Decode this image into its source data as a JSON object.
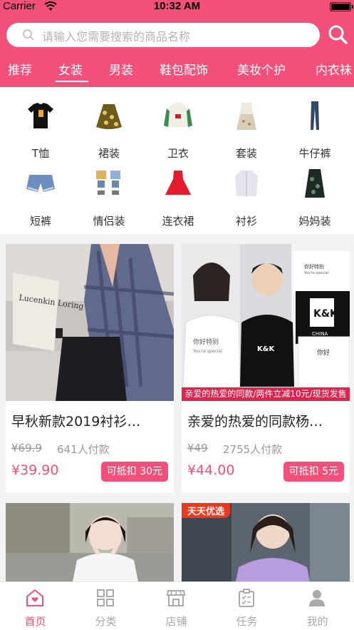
{
  "status_bar": {
    "carrier": "Carrier",
    "time": "10:32 AM"
  },
  "search": {
    "placeholder": "请输入您需要搜索的商品名称"
  },
  "tabs": [
    "推荐",
    "女装",
    "男装",
    "鞋包配饰",
    "美妆个护",
    "内衣袜"
  ],
  "active_tab": "女装",
  "categories": [
    {
      "label": "T恤",
      "icon": "tshirt-icon"
    },
    {
      "label": "裙装",
      "icon": "skirt-icon"
    },
    {
      "label": "卫衣",
      "icon": "hoodie-icon"
    },
    {
      "label": "套装",
      "icon": "suit-icon"
    },
    {
      "label": "牛仔裤",
      "icon": "jeans-icon"
    },
    {
      "label": "短裤",
      "icon": "shorts-icon"
    },
    {
      "label": "情侣装",
      "icon": "couple-outfit-icon"
    },
    {
      "label": "连衣裙",
      "icon": "dress-icon"
    },
    {
      "label": "衬衫",
      "icon": "shirt-icon"
    },
    {
      "label": "妈妈装",
      "icon": "mom-wear-icon"
    }
  ],
  "products": [
    {
      "title": "早秋新款2019衬衫…",
      "original_price": "¥69.9",
      "paid_count": "641人付款",
      "price": "¥39.90",
      "coupon": "可抵扣 30元",
      "image_text": "Lucenkin Loring"
    },
    {
      "title": "亲爱的热爱的同款杨…",
      "original_price": "¥49",
      "paid_count": "2755人付款",
      "price": "¥44.00",
      "coupon": "可抵扣 5元",
      "banner": "亲爱的热爱的同款/两件立减10元/现货发售",
      "image_text": {
        "shirt1": "你好特别",
        "shirt1_sub": "You're special",
        "logo": "K&K",
        "logo_box": "K&K",
        "logo_sub": "CHINA",
        "shirt_small": "你好特别",
        "shirt_small_sub": "You're special",
        "shirt_bottom": "你好"
      }
    },
    {
      "image": "girl-photo"
    },
    {
      "tag": "天天优选",
      "image": "girl-purple-tshirt-photo"
    }
  ],
  "tab_bar": [
    {
      "label": "首页",
      "icon": "home-icon",
      "active": true
    },
    {
      "label": "分类",
      "icon": "grid-icon",
      "active": false
    },
    {
      "label": "店铺",
      "icon": "store-icon",
      "active": false
    },
    {
      "label": "任务",
      "icon": "task-icon",
      "active": false
    },
    {
      "label": "我的",
      "icon": "user-icon",
      "active": false
    }
  ],
  "colors": {
    "brand": "#f2507b",
    "banner": "#e0234e",
    "tag": "#e93a1f"
  }
}
